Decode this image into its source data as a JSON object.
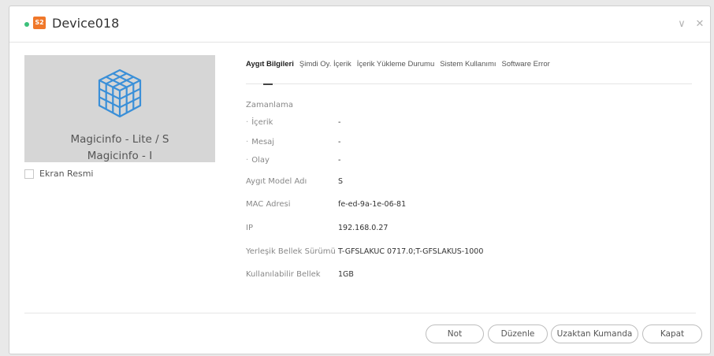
{
  "header": {
    "badge": "S2",
    "title": "Device018",
    "status_color": "#3cc07a",
    "badge_color": "#f0782a",
    "icons": [
      "chevron-down-icon",
      "close-icon"
    ],
    "minimize_glyph": "∨",
    "close_glyph": "✕"
  },
  "preview": {
    "line1": "Magicinfo - Lite / S",
    "line2": "Magicinfo - I",
    "icon": "cube-icon",
    "screenshot_label": "Ekran Resmi"
  },
  "tabs": [
    {
      "label": "Aygıt Bilgileri",
      "active": true
    },
    {
      "label": "Şimdi Oy. İçerik",
      "active": false
    },
    {
      "label": "İçerik Yükleme Durumu",
      "active": false
    },
    {
      "label": "Sistem Kullanımı",
      "active": false
    },
    {
      "label": "Software Error",
      "active": false
    }
  ],
  "info": {
    "schedule_title": "Zamanlama",
    "bullet": "·",
    "rows": [
      {
        "label": "İçerik",
        "value": "-"
      },
      {
        "label": "Mesaj",
        "value": "-"
      },
      {
        "label": "Olay",
        "value": "-"
      },
      {
        "label": "Aygıt Model Adı",
        "value": "S"
      },
      {
        "label": "MAC Adresi",
        "value": "fe-ed-9a-1e-06-81"
      },
      {
        "label": "IP",
        "value": "192.168.0.27"
      },
      {
        "label": "Yerleşik Bellek Sürümü",
        "value": "T-GFSLAKUC 0717.0;T-GFSLAKUS-1000"
      },
      {
        "label": "Kullanılabilir Bellek",
        "value": "1GB"
      }
    ]
  },
  "footer": {
    "buttons": [
      "Not",
      "Düzenle",
      "Uzaktan Kumanda",
      "Kapat"
    ]
  }
}
